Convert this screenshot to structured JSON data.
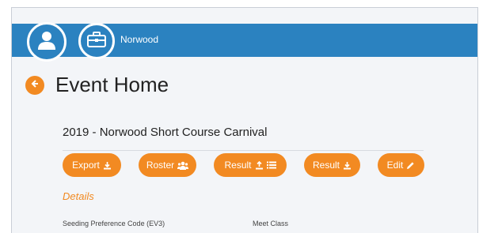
{
  "header": {
    "organization": "Norwood",
    "icons": {
      "user": "user-icon",
      "organization": "briefcase-icon"
    }
  },
  "page": {
    "title": "Event Home",
    "back_icon": "arrow-left-icon",
    "event_name": "2019 - Norwood Short Course Carnival"
  },
  "actions": [
    {
      "label": "Export",
      "icon": "download-icon"
    },
    {
      "label": "Roster",
      "icon": "users-icon"
    },
    {
      "label": "Result",
      "icons": [
        "upload-icon",
        "list-icon"
      ]
    },
    {
      "label": "Result",
      "icon": "download-icon"
    },
    {
      "label": "Edit",
      "icon": "pencil-icon"
    }
  ],
  "details": {
    "heading": "Details",
    "fields": [
      {
        "label": "Seeding Preference Code (EV3)"
      },
      {
        "label": "Meet Class"
      }
    ]
  },
  "colors": {
    "header_blue": "#2b82c0",
    "accent_orange": "#f28a22",
    "background": "#f3f5f8"
  }
}
